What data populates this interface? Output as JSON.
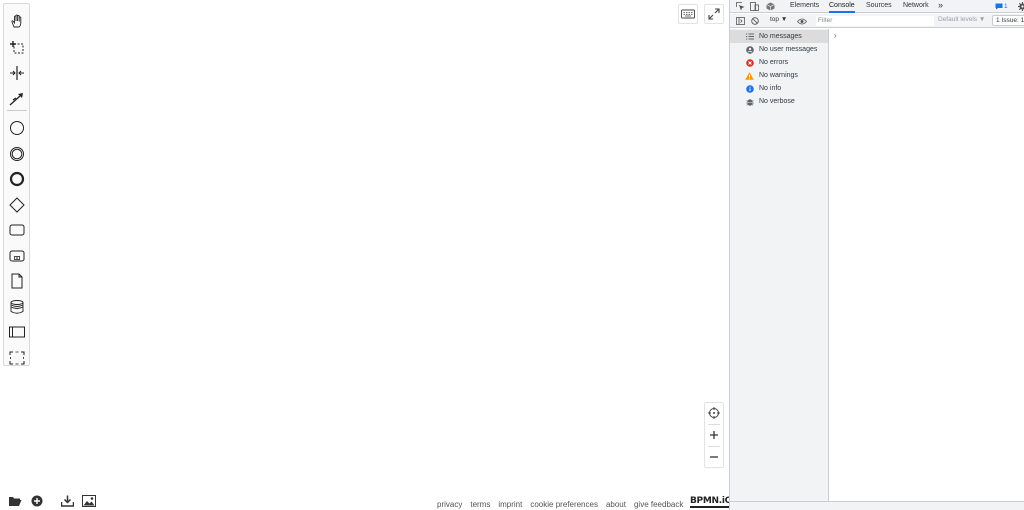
{
  "canvas": {
    "palette": {
      "tools": [
        {
          "name": "hand-tool",
          "icon": "hand-icon"
        },
        {
          "name": "lasso-tool",
          "icon": "lasso-icon"
        },
        {
          "name": "space-tool",
          "icon": "space-tool-icon"
        },
        {
          "name": "global-connect-tool",
          "icon": "connect-icon"
        }
      ],
      "shapes": [
        {
          "name": "start-event",
          "icon": "start-event-icon"
        },
        {
          "name": "intermediate-event",
          "icon": "intermediate-event-icon"
        },
        {
          "name": "end-event",
          "icon": "end-event-icon"
        },
        {
          "name": "gateway",
          "icon": "gateway-icon"
        },
        {
          "name": "task",
          "icon": "task-icon"
        },
        {
          "name": "subprocess",
          "icon": "subprocess-icon"
        },
        {
          "name": "data-object",
          "icon": "data-object-icon"
        },
        {
          "name": "data-store",
          "icon": "data-store-icon"
        },
        {
          "name": "pool",
          "icon": "pool-icon"
        },
        {
          "name": "group",
          "icon": "group-icon"
        }
      ]
    },
    "footer_links": [
      "privacy",
      "terms",
      "imprint",
      "cookie preferences",
      "about",
      "give feedback"
    ],
    "logo": "BPMN.iO"
  },
  "devtools": {
    "tabs": [
      {
        "label": "Elements",
        "active": false
      },
      {
        "label": "Console",
        "active": true
      },
      {
        "label": "Sources",
        "active": false
      },
      {
        "label": "Network",
        "active": false
      }
    ],
    "more_tabs": "»",
    "issue_badge": "1",
    "toolbar": {
      "context": "top ▼",
      "filter_placeholder": "Filter",
      "levels": "Default levels ▼",
      "issues": "1 Issue: 1"
    },
    "sidebar": [
      {
        "label": "No messages",
        "icon": "list-icon",
        "color": "#5f6368",
        "selected": true
      },
      {
        "label": "No user messages",
        "icon": "user-icon",
        "color": "#5f6368",
        "selected": false
      },
      {
        "label": "No errors",
        "icon": "error-icon",
        "color": "#d93025",
        "selected": false
      },
      {
        "label": "No warnings",
        "icon": "warning-icon",
        "color": "#f29900",
        "selected": false
      },
      {
        "label": "No info",
        "icon": "info-icon",
        "color": "#1a73e8",
        "selected": false
      },
      {
        "label": "No verbose",
        "icon": "verbose-icon",
        "color": "#5f6368",
        "selected": false
      }
    ],
    "prompt": "›"
  },
  "colors": {
    "accent": "#1a73e8",
    "error": "#d93025",
    "warning": "#f29900"
  }
}
